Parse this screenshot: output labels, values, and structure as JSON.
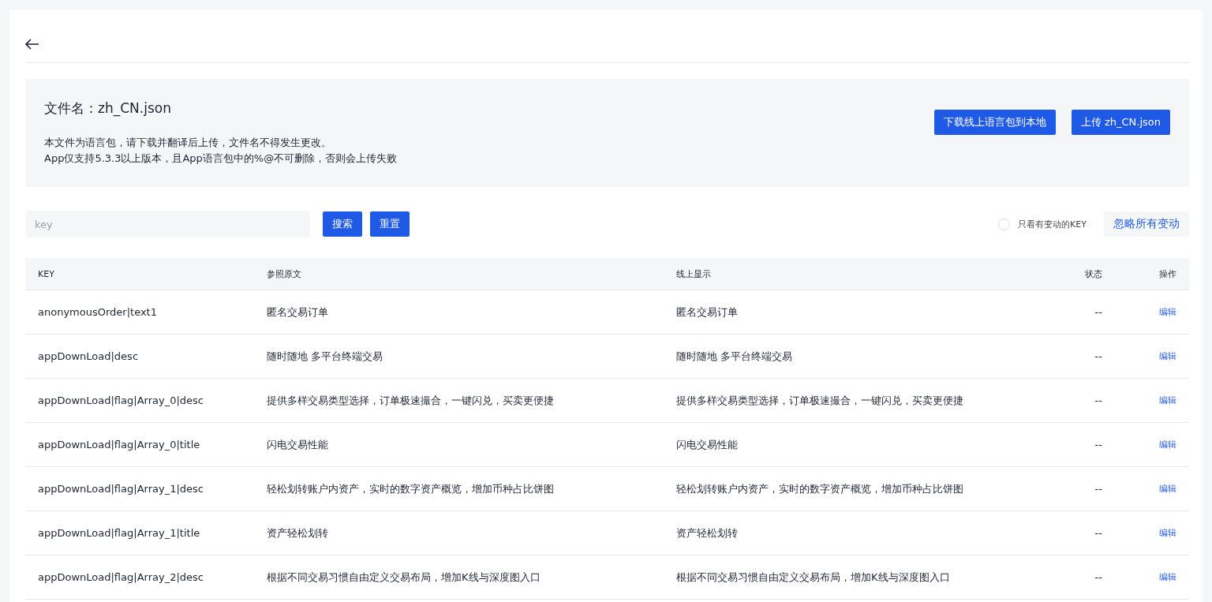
{
  "file_info": {
    "title": "文件名：zh_CN.json",
    "notes": [
      "本文件为语言包，请下载并翻译后上传，文件名不得发生更改。",
      "App仅支持5.3.3以上版本，且App语言包中的%@不可删除，否则会上传失败"
    ],
    "buttons": [
      "下载线上语言包到本地",
      "上传 zh_CN.json"
    ]
  },
  "search": {
    "placeholder": "key",
    "buttons": [
      "搜索",
      "重置"
    ]
  },
  "filter": {
    "label": "只看有变动的KEY",
    "checked": false
  },
  "ignore_button": "忽略所有变动",
  "table": {
    "columns": [
      "KEY",
      "参照原文",
      "线上显示",
      "状态",
      "操作"
    ],
    "rows": [
      {
        "key": "anonymousOrder|text1",
        "reference": "匿名交易订单",
        "online": "匿名交易订单",
        "status": "--",
        "action": "编辑"
      },
      {
        "key": "appDownLoad|desc",
        "reference": "随时随地 多平台终端交易",
        "online": "随时随地 多平台终端交易",
        "status": "--",
        "action": "编辑"
      },
      {
        "key": "appDownLoad|flag|Array_0|desc",
        "reference": "提供多样交易类型选择，订单极速撮合，一键闪兑，买卖更便捷",
        "online": "提供多样交易类型选择，订单极速撮合，一键闪兑，买卖更便捷",
        "status": "--",
        "action": "编辑"
      },
      {
        "key": "appDownLoad|flag|Array_0|title",
        "reference": "闪电交易性能",
        "online": "闪电交易性能",
        "status": "--",
        "action": "编辑"
      },
      {
        "key": "appDownLoad|flag|Array_1|desc",
        "reference": "轻松划转账户内资产，实时的数字资产概览，增加币种占比饼图",
        "online": "轻松划转账户内资产，实时的数字资产概览，增加币种占比饼图",
        "status": "--",
        "action": "编辑"
      },
      {
        "key": "appDownLoad|flag|Array_1|title",
        "reference": "资产轻松划转",
        "online": "资产轻松划转",
        "status": "--",
        "action": "编辑"
      },
      {
        "key": "appDownLoad|flag|Array_2|desc",
        "reference": "根据不同交易习惯自由定义交易布局，增加K线与深度图入口",
        "online": "根据不同交易习惯自由定义交易布局，增加K线与深度图入口",
        "status": "--",
        "action": "编辑"
      }
    ]
  }
}
